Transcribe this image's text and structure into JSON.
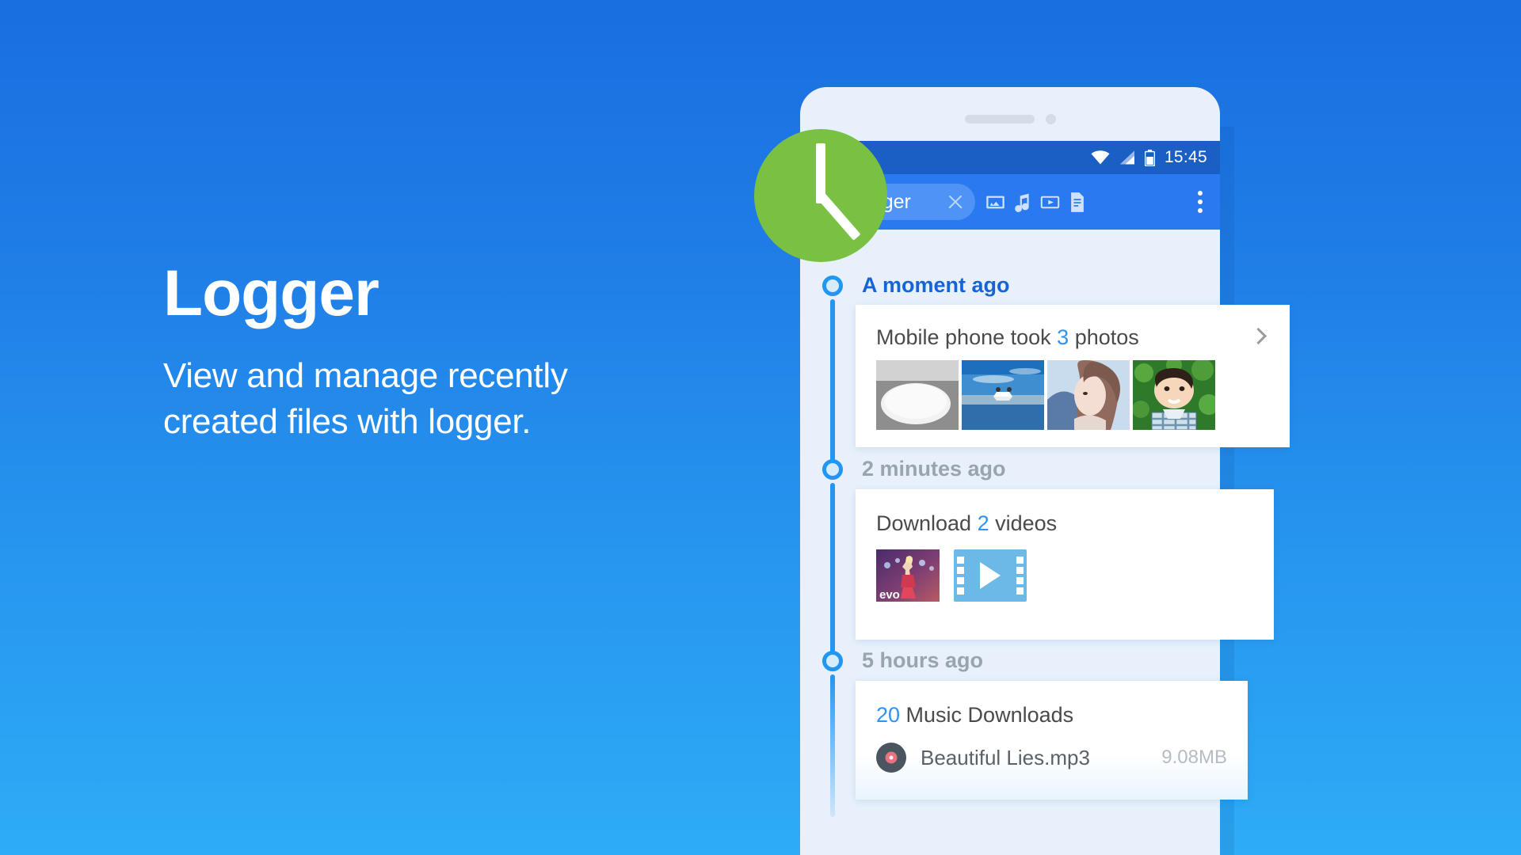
{
  "brand": {
    "title": "Logger",
    "subtitle": "View and manage recently created files with logger."
  },
  "colors": {
    "bg_top": "#1a6ee0",
    "bg_bottom": "#2eacf6",
    "accent_blue": "#2196f3",
    "toolbar_blue": "#2979f0",
    "statusbar_blue": "#1b5fc4",
    "badge_green": "#7ac143",
    "active_label": "#1565d8",
    "muted_label": "#9aa4ad"
  },
  "logo": {
    "icon": "clock-icon"
  },
  "phone": {
    "statusbar": {
      "time": "15:45",
      "icons": [
        "wifi-icon",
        "signal-icon",
        "battery-icon"
      ]
    },
    "toolbar": {
      "chip": {
        "icon": "clock-icon",
        "label": "Logger",
        "close_icon": "close-icon"
      },
      "filters": [
        "image-icon",
        "music-icon",
        "video-icon",
        "document-icon"
      ],
      "overflow_icon": "more-vertical-icon"
    }
  },
  "timeline": [
    {
      "time_label": "A moment ago",
      "state": "active",
      "card": {
        "title_prefix": "Mobile phone took ",
        "count": "3",
        "title_suffix": " photos",
        "chevron": "chevron-right-icon",
        "thumbnails": [
          "white-oval-object-photo",
          "bird-over-water-photo",
          "woman-profile-photo",
          "boy-on-grass-photo"
        ]
      }
    },
    {
      "time_label": "2 minutes ago",
      "state": "muted",
      "card": {
        "title_prefix": "Download ",
        "count": "2",
        "title_suffix": " videos",
        "thumbnails": [
          "concert-performer-video",
          "video-placeholder-icon"
        ]
      }
    },
    {
      "time_label": "5 hours ago",
      "state": "muted",
      "card": {
        "count": "20",
        "title_suffix": " Music Downloads",
        "files": [
          {
            "icon": "vinyl-record-icon",
            "name": "Beautiful Lies.mp3",
            "size": "9.08MB"
          }
        ]
      }
    }
  ]
}
